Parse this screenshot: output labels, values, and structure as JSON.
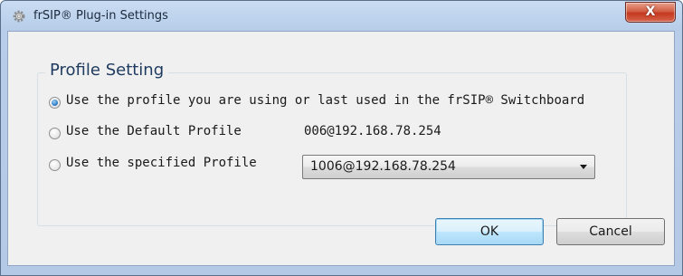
{
  "window": {
    "title": "frSIP® Plug-in Settings",
    "close_label": "X",
    "icon": "gear-icon"
  },
  "group": {
    "title": "Profile Setting"
  },
  "options": [
    {
      "label": "Use the profile you are using or last used in the frSIP® Switchboard",
      "checked": true
    },
    {
      "label": "Use the Default Profile",
      "checked": false
    },
    {
      "label": "Use the specified Profile",
      "checked": false
    }
  ],
  "default_profile_value": "006@192.168.78.254",
  "specified_profile": {
    "selected": "1006@192.168.78.254"
  },
  "buttons": {
    "ok": "OK",
    "cancel": "Cancel"
  },
  "colors": {
    "title_bar": "#b7cde9",
    "close_button": "#c4381f",
    "client_background": "#f0f0f0",
    "group_title": "#1e3a5f",
    "ok_button_border": "#3c7fb1"
  }
}
